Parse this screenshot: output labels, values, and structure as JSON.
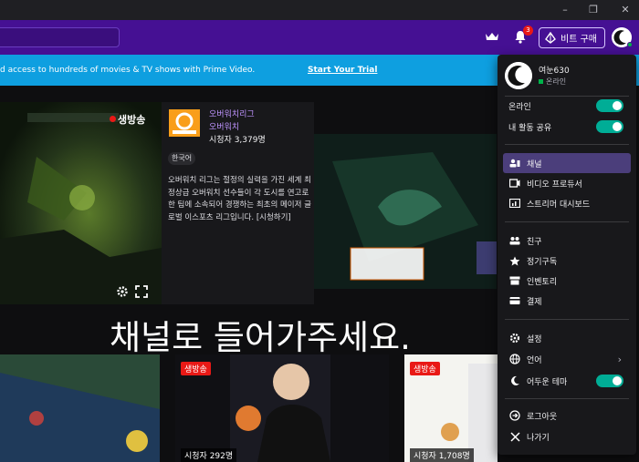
{
  "window_controls": {
    "minimize": "–",
    "restore": "❐",
    "close": "✕"
  },
  "nav": {
    "bits_button_label": "비트 구매",
    "notification_count": "3"
  },
  "prime_banner": {
    "text": "d access to hundreds of movies & TV shows with Prime Video.",
    "link": "Start Your Trial"
  },
  "featured": {
    "live_label": "생방송",
    "channel_name": "오버워치리그",
    "game": "오버워치",
    "viewers": "시청자 3,379명",
    "tag": "한국어",
    "description": "오버워치 리그는 절정의 실력을 가진 세계 최정상급 오버워치 선수들이 각 도시를 연고로 한 팀에 소속되어 경쟁하는 최초의 메이저 글로벌 이스포츠 리그입니다. [시청하기]"
  },
  "overlay_caption": "채널로 들어가주세요.",
  "cards": [
    {
      "live": "",
      "viewers": ""
    },
    {
      "live": "생방송",
      "viewers": "시청자 292명"
    },
    {
      "live": "생방송",
      "viewers": "시청자 1,708명"
    }
  ],
  "user_menu": {
    "username": "여눈630",
    "status": "온라인",
    "items": {
      "online": "온라인",
      "share_activity": "내 활동 공유",
      "channel": "채널",
      "video_producer": "비디오 프로듀서",
      "dashboard": "스트리머 대시보드",
      "friends": "친구",
      "subscriptions": "정기구독",
      "inventory": "인벤토리",
      "payment": "결제",
      "settings": "설정",
      "language": "언어",
      "dark_theme": "어두운 테마",
      "logout": "로그아웃",
      "exit": "나가기"
    }
  },
  "colors": {
    "nav": "#451093",
    "banner": "#0e9fe0",
    "accent": "#9147ff",
    "toggle_on": "#00ad96",
    "live": "#e91916"
  }
}
